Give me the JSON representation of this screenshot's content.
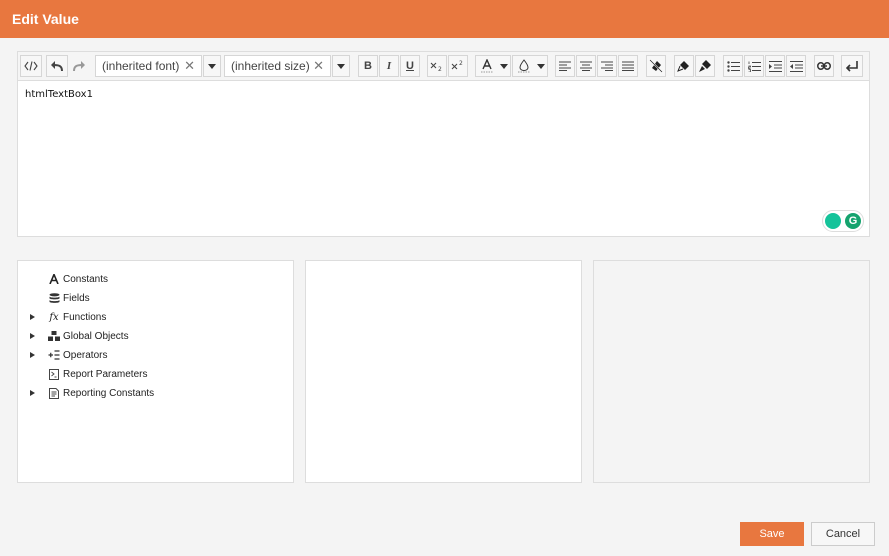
{
  "dialog": {
    "title": "Edit Value"
  },
  "toolbar": {
    "font_value": "(inherited font)",
    "size_value": "(inherited size)",
    "clear_glyph": "✕",
    "bold_label": "B",
    "italic_label": "I",
    "underline_label": "U"
  },
  "editor": {
    "content": "htmlTextBox1"
  },
  "tree": {
    "items": [
      {
        "label": "Constants",
        "icon": "letter-a-icon",
        "expandable": false
      },
      {
        "label": "Fields",
        "icon": "database-icon",
        "expandable": false
      },
      {
        "label": "Functions",
        "icon": "function-icon",
        "expandable": true
      },
      {
        "label": "Global Objects",
        "icon": "objects-icon",
        "expandable": true
      },
      {
        "label": "Operators",
        "icon": "operators-icon",
        "expandable": true
      },
      {
        "label": "Report Parameters",
        "icon": "parameters-icon",
        "expandable": false
      },
      {
        "label": "Reporting Constants",
        "icon": "reporting-constants-icon",
        "expandable": true
      }
    ]
  },
  "footer": {
    "save_label": "Save",
    "cancel_label": "Cancel"
  },
  "colors": {
    "accent": "#e8773f"
  }
}
